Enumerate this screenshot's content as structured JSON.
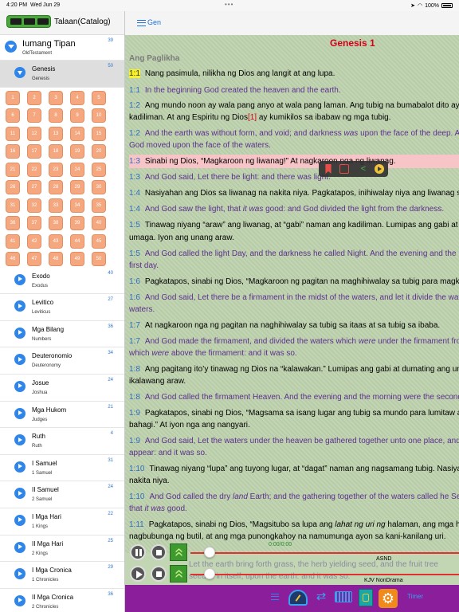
{
  "status_bar": {
    "time": "4:20 PM",
    "date": "Wed Jun 29",
    "battery": "100%",
    "dots": "•••"
  },
  "sidebar": {
    "title": "Talaan(Catalog)",
    "testament": {
      "name": "Iumang Tipan",
      "subtitle": "OldTestament",
      "count": "39"
    },
    "selected_book": {
      "name": "Genesis",
      "subtitle": "Genesis",
      "count": "50"
    },
    "chapters": [
      "1",
      "2",
      "3",
      "4",
      "5",
      "6",
      "7",
      "8",
      "9",
      "10",
      "11",
      "12",
      "13",
      "14",
      "15",
      "16",
      "17",
      "18",
      "19",
      "20",
      "21",
      "22",
      "23",
      "24",
      "25",
      "26",
      "27",
      "28",
      "29",
      "30",
      "31",
      "32",
      "33",
      "34",
      "35",
      "36",
      "37",
      "38",
      "39",
      "40",
      "41",
      "42",
      "43",
      "44",
      "45",
      "46",
      "47",
      "48",
      "49",
      "50"
    ],
    "books": [
      {
        "name": "Exodo",
        "subtitle": "Exodus",
        "count": "40"
      },
      {
        "name": "Levitico",
        "subtitle": "Leviticus",
        "count": "27"
      },
      {
        "name": "Mga Bilang",
        "subtitle": "Numbers",
        "count": "36"
      },
      {
        "name": "Deuteronomio",
        "subtitle": "Deuteronomy",
        "count": "34"
      },
      {
        "name": "Josue",
        "subtitle": "Joshua",
        "count": "24"
      },
      {
        "name": "Mga Hukom",
        "subtitle": "Judges",
        "count": "21"
      },
      {
        "name": "Ruth",
        "subtitle": "Ruth",
        "count": "4"
      },
      {
        "name": "I Samuel",
        "subtitle": "1 Samuel",
        "count": "31"
      },
      {
        "name": "II Samuel",
        "subtitle": "2 Samuel",
        "count": "24"
      },
      {
        "name": "I Mga Hari",
        "subtitle": "1 Kings",
        "count": "22"
      },
      {
        "name": "II Mga Hari",
        "subtitle": "2 Kings",
        "count": "25"
      },
      {
        "name": "I Mga Cronica",
        "subtitle": "1 Chronicles",
        "count": "29"
      },
      {
        "name": "II Mga Cronica",
        "subtitle": "2 Chronicles",
        "count": "36"
      }
    ]
  },
  "main": {
    "nav_label": "Gen",
    "chapter_title": "Genesis 1",
    "section_heading": "Ang Paglikha",
    "verses": [
      {
        "n": "1:1",
        "t": "Nang pasimula, nilikha ng Dios ang langit at ang lupa."
      },
      {
        "n": "1:1",
        "t": "In the beginning God created the heaven and the earth."
      },
      {
        "n": "1:2",
        "t": "Ang mundo noon ay wala pang anyo at wala pang laman. Ang tubig na bumabalot dito ay nababalot ng"
      },
      {
        "n": "",
        "t": "kadiliman. At ang Espiritu ng Dios"
      },
      {
        "n": "",
        "t": "[1]"
      },
      {
        "n": "",
        "t": " ay kumikilos sa ibabaw ng mga tubig."
      },
      {
        "n": "1:2",
        "t": "And the earth was without form, and void; and darkness "
      },
      {
        "n": "",
        "t": "was"
      },
      {
        "n": "",
        "t": " upon the face of the deep. And the Spirit of"
      },
      {
        "n": "",
        "t": "God moved upon the face of the waters."
      },
      {
        "n": "1:3",
        "t": "Sinabi ng Dios, “Magkaroon ng liwanag!” At nagkaroon nga ng liwanag."
      },
      {
        "n": "1:3",
        "t": "And God said, Let there be light: and there was light."
      },
      {
        "n": "1:4",
        "t": "Nasiyahan ang Dios sa liwanag na nakita niya. Pagkatapos, inihiwalay niya ang liwanag sa dilim."
      },
      {
        "n": "1:4",
        "t": "And God saw the light, that "
      },
      {
        "n": "",
        "t": "it was"
      },
      {
        "n": "",
        "t": " good: and God divided the light from the darkness."
      },
      {
        "n": "1:5",
        "t": "Tinawag niyang “araw” ang liwanag, at “gabi” naman ang kadiliman. Lumipas ang gabi at dumating ang"
      },
      {
        "n": "",
        "t": "umaga. Iyon ang unang araw."
      },
      {
        "n": "1:5",
        "t": "And God called the light Day, and the darkness he called Night. And the evening and the morning were the"
      },
      {
        "n": "",
        "t": "first day."
      },
      {
        "n": "1:6",
        "t": "Pagkatapos, sinabi ng Dios, “Magkaroon ng pagitan na maghihiwalay sa tubig para magkaroon ng dalawang"
      },
      {
        "n": "1:6",
        "t": "And God said, Let there be a firmament in the midst of the waters, and let it divide the waters from the"
      },
      {
        "n": "",
        "t": "waters."
      },
      {
        "n": "1:7",
        "t": "At nagkaroon nga ng pagitan na naghihiwalay sa tubig sa itaas at sa tubig sa ibaba."
      },
      {
        "n": "1:7",
        "t": "And God made the firmament, and divided the waters which "
      },
      {
        "n": "",
        "t": "were"
      },
      {
        "n": "",
        "t": " under the firmament from the waters"
      },
      {
        "n": "",
        "t": "which "
      },
      {
        "n": "",
        "t": " above the firmament: and it was so."
      },
      {
        "n": "1:8",
        "t": "Ang pagitang ito’y tinawag ng Dios na “kalawakan.” Lumipas ang gabi at dumating ang umaga. Iyon ang"
      },
      {
        "n": "",
        "t": "ikalawang araw."
      },
      {
        "n": "1:8",
        "t": "And God called the firmament Heaven. And the evening and the morning were the second day."
      },
      {
        "n": "1:9",
        "t": "Pagkatapos, sinabi ng Dios, “Magsama sa isang lugar ang tubig sa mundo para lumitaw ang lupa.” At nangyari nga ang"
      },
      {
        "n": "",
        "t": "bahagi.” At iyon nga ang nangyari."
      },
      {
        "n": "1:9",
        "t": "And God said, Let the waters under the heaven be gathered together unto one place, and let the dry "
      },
      {
        "n": "",
        "t": "land"
      },
      {
        "n": "",
        "t": "appear: and it was so."
      },
      {
        "n": "1:10",
        "t": "Tinawag niyang “lupa” ang tuyong lugar, at “dagat” naman ang nagsamang tubig. Nasiyahan ang Dios nang"
      },
      {
        "n": "",
        "t": "nakita niya."
      },
      {
        "n": "1:10",
        "t": "And God called the dry "
      },
      {
        "n": "",
        "t": " Earth; and the gathering together of the waters called he Seas: and God saw"
      },
      {
        "n": "",
        "t": "that "
      },
      {
        "n": "",
        "t": " good."
      },
      {
        "n": "1:11",
        "t": "Pagkatapos, sinabi ng Dios, “Magsitubo sa lupa ang "
      },
      {
        "n": "",
        "t": "lahat ng uri ng"
      },
      {
        "n": "",
        "t": " halaman, ang mga halamang"
      },
      {
        "n": "",
        "t": "nagbubunga ng butil, at ang mga punongkahoy na namumunga ayon sa kani-kanilang uri."
      },
      {
        "n": "",
        "t": "Let the earth bring forth grass, the herb yielding seed, and the fruit tree"
      },
      {
        "n": "",
        "t": "seed is in itself, upon the earth: and it was so."
      }
    ]
  },
  "player": {
    "track1_label": "ASND",
    "track1_time": "0:00/0:00",
    "track2_label": "KJV NonDrama",
    "progress1": 0.05,
    "progress2": 0.05
  },
  "toolbar": {
    "timer_label": "Timer"
  },
  "colors": {
    "toolbar": "#8b1e9b",
    "chapter_tile": "#f5a87f",
    "title_red": "#d4001a",
    "verse_num": "#2d6dc0",
    "english_text": "#5b2f8d",
    "highlight_yellow": "#f7f02a",
    "highlight_pink": "#f7c4c7"
  }
}
